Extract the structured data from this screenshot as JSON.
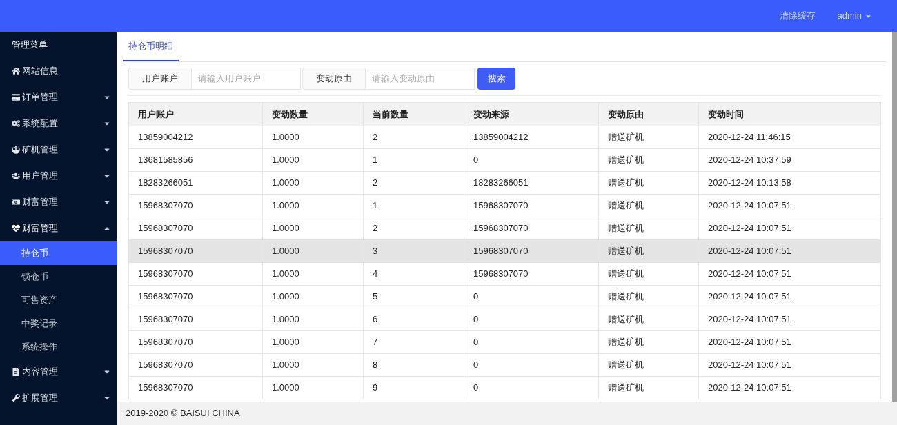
{
  "header": {
    "links": [
      "清除缓存"
    ],
    "user": "admin"
  },
  "sidebar": {
    "title": "管理菜单",
    "items": [
      {
        "kind": "home",
        "label": "网站信息",
        "expanded": false,
        "has_caret": false
      },
      {
        "kind": "card",
        "label": "订单管理",
        "expanded": false,
        "has_caret": true
      },
      {
        "kind": "cogs",
        "label": "系统配置",
        "expanded": false,
        "has_caret": true
      },
      {
        "kind": "rebel",
        "label": "矿机管理",
        "expanded": false,
        "has_caret": true
      },
      {
        "kind": "users",
        "label": "用户管理",
        "expanded": false,
        "has_caret": true
      },
      {
        "kind": "money",
        "label": "财富管理",
        "expanded": false,
        "has_caret": true
      },
      {
        "kind": "heartbeat",
        "label": "财富管理",
        "expanded": true,
        "has_caret": true,
        "children": [
          {
            "label": "持仓币",
            "selected": true
          },
          {
            "label": "锁仓币",
            "selected": false
          },
          {
            "label": "可售资产",
            "selected": false
          },
          {
            "label": "中奖记录",
            "selected": false
          },
          {
            "label": "系统操作",
            "selected": false
          }
        ]
      },
      {
        "kind": "file",
        "label": "内容管理",
        "expanded": false,
        "has_caret": true
      },
      {
        "kind": "wrench",
        "label": "扩展管理",
        "expanded": false,
        "has_caret": true
      }
    ]
  },
  "tabs": [
    {
      "label": "持仓币明细",
      "selected": true
    }
  ],
  "search": {
    "fields": [
      {
        "label": "用户账户",
        "placeholder": "请输入用户账户"
      },
      {
        "label": "变动原由",
        "placeholder": "请输入变动原由"
      }
    ],
    "button": "搜索"
  },
  "table": {
    "columns": [
      "用户账户",
      "变动数量",
      "当前数量",
      "变动来源",
      "变动原由",
      "变动时间"
    ],
    "rows": [
      {
        "selected": false,
        "cells": [
          "13859004212",
          "1.0000",
          "2",
          "13859004212",
          "赠送矿机",
          "2020-12-24 11:46:15"
        ]
      },
      {
        "selected": false,
        "cells": [
          "13681585856",
          "1.0000",
          "1",
          "0",
          "赠送矿机",
          "2020-12-24 10:37:59"
        ]
      },
      {
        "selected": false,
        "cells": [
          "18283266051",
          "1.0000",
          "2",
          "18283266051",
          "赠送矿机",
          "2020-12-24 10:13:58"
        ]
      },
      {
        "selected": false,
        "cells": [
          "15968307070",
          "1.0000",
          "1",
          "15968307070",
          "赠送矿机",
          "2020-12-24 10:07:51"
        ]
      },
      {
        "selected": false,
        "cells": [
          "15968307070",
          "1.0000",
          "2",
          "15968307070",
          "赠送矿机",
          "2020-12-24 10:07:51"
        ]
      },
      {
        "selected": true,
        "cells": [
          "15968307070",
          "1.0000",
          "3",
          "15968307070",
          "赠送矿机",
          "2020-12-24 10:07:51"
        ]
      },
      {
        "selected": false,
        "cells": [
          "15968307070",
          "1.0000",
          "4",
          "15968307070",
          "赠送矿机",
          "2020-12-24 10:07:51"
        ]
      },
      {
        "selected": false,
        "cells": [
          "15968307070",
          "1.0000",
          "5",
          "0",
          "赠送矿机",
          "2020-12-24 10:07:51"
        ]
      },
      {
        "selected": false,
        "cells": [
          "15968307070",
          "1.0000",
          "6",
          "0",
          "赠送矿机",
          "2020-12-24 10:07:51"
        ]
      },
      {
        "selected": false,
        "cells": [
          "15968307070",
          "1.0000",
          "7",
          "0",
          "赠送矿机",
          "2020-12-24 10:07:51"
        ]
      },
      {
        "selected": false,
        "cells": [
          "15968307070",
          "1.0000",
          "8",
          "0",
          "赠送矿机",
          "2020-12-24 10:07:51"
        ]
      },
      {
        "selected": false,
        "cells": [
          "15968307070",
          "1.0000",
          "9",
          "0",
          "赠送矿机",
          "2020-12-24 10:07:51"
        ]
      }
    ]
  },
  "footer": "2019-2020 © BAISUI CHINA"
}
